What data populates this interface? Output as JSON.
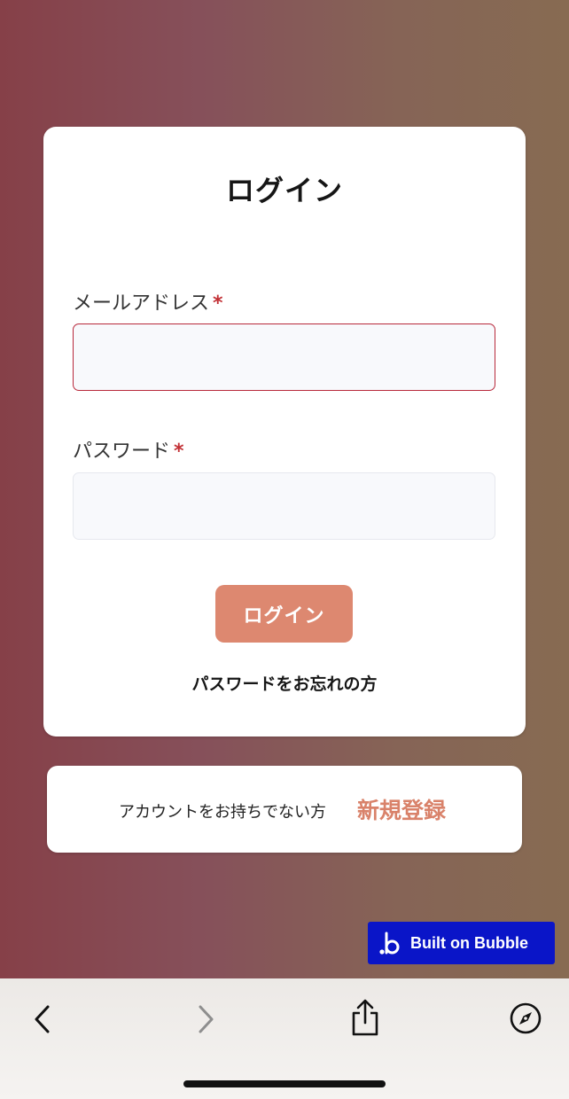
{
  "login_card": {
    "title": "ログイン",
    "email": {
      "label": "メールアドレス",
      "required_mark": "*",
      "value": "",
      "placeholder": ""
    },
    "password": {
      "label": "パスワード",
      "required_mark": "*",
      "value": "",
      "placeholder": ""
    },
    "submit_label": "ログイン",
    "forgot_password": "パスワードをお忘れの方"
  },
  "signup_card": {
    "prompt": "アカウントをお持ちでない方",
    "link": "新規登録"
  },
  "badge": {
    "text": "Built on Bubble"
  },
  "browser_toolbar": {
    "icons": [
      "back-icon",
      "forward-icon",
      "share-icon",
      "compass-icon"
    ]
  },
  "colors": {
    "accent": "#dd8870",
    "required": "#c23035",
    "focus_border": "#b8283b",
    "badge_bg": "#0a15c8"
  }
}
